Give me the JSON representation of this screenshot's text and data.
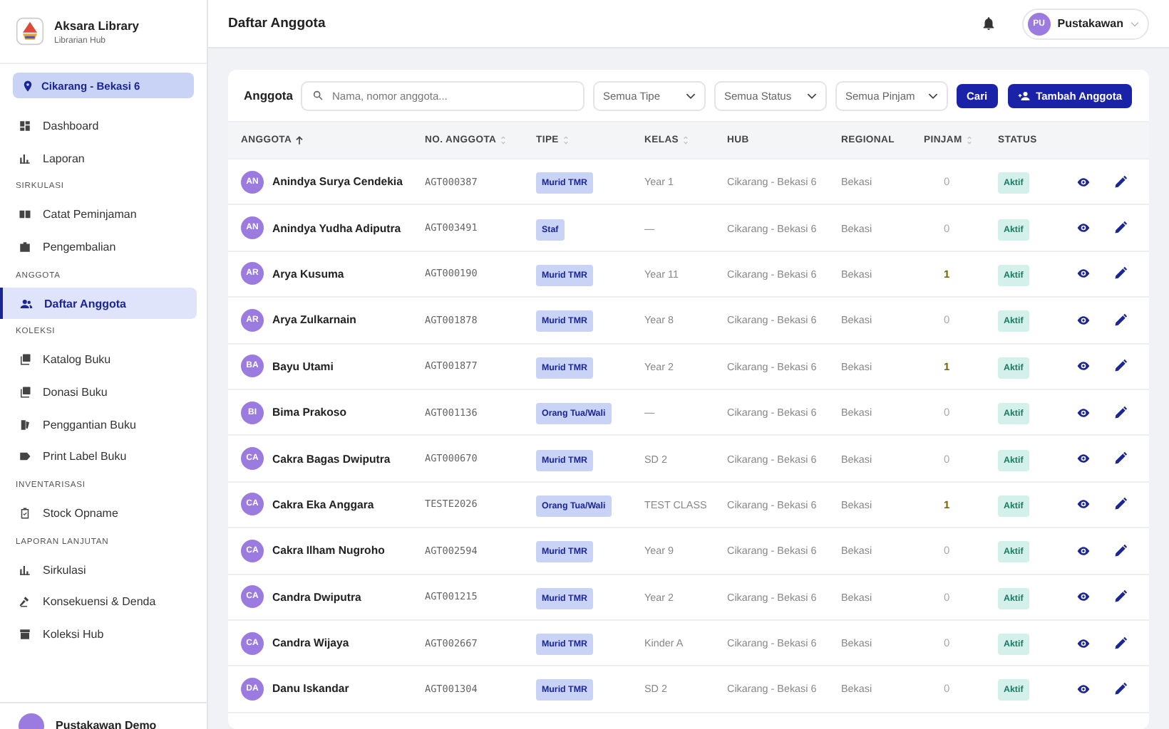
{
  "brand": {
    "name": "Aksara Library",
    "subtitle": "Librarian Hub"
  },
  "sidebar": {
    "location": "Cikarang - Bekasi 6",
    "sections": [
      {
        "items": [
          {
            "label": "Dashboard",
            "selected": false
          },
          {
            "label": "Laporan",
            "selected": false
          }
        ]
      },
      {
        "heading": "SIRKULASI",
        "items": [
          {
            "label": "Catat Peminjaman",
            "selected": false
          },
          {
            "label": "Pengembalian",
            "selected": false
          }
        ]
      },
      {
        "heading": "ANGGOTA",
        "items": [
          {
            "label": "Daftar Anggota",
            "selected": true
          }
        ]
      },
      {
        "heading": "KOLEKSI",
        "items": [
          {
            "label": "Katalog Buku",
            "selected": false
          },
          {
            "label": "Donasi Buku",
            "selected": false
          },
          {
            "label": "Penggantian Buku",
            "selected": false
          },
          {
            "label": "Print Label Buku",
            "selected": false
          }
        ]
      },
      {
        "heading": "INVENTARISASI",
        "items": [
          {
            "label": "Stock Opname",
            "selected": false
          }
        ]
      },
      {
        "heading": "LAPORAN LANJUTAN",
        "items": [
          {
            "label": "Sirkulasi",
            "selected": false
          },
          {
            "label": "Konsekuensi & Denda",
            "selected": false
          },
          {
            "label": "Koleksi Hub",
            "selected": false
          }
        ]
      }
    ],
    "user": "Pustakawan Demo"
  },
  "header": {
    "title": "Daftar Anggota",
    "user_initials": "PU",
    "user_name": "Pustakawan"
  },
  "toolbar": {
    "title": "Anggota",
    "search_placeholder": "Nama, nomor anggota...",
    "filters": [
      "Semua Tipe",
      "Semua Status",
      "Semua Pinjam"
    ],
    "search_button": "Cari",
    "add_button": "Tambah Anggota"
  },
  "table": {
    "columns": [
      {
        "label": "ANGGOTA",
        "sortable": true,
        "sorted": true
      },
      {
        "label": "NO. ANGGOTA",
        "sortable": true,
        "sorted": false
      },
      {
        "label": "TIPE",
        "sortable": true,
        "sorted": false
      },
      {
        "label": "KELAS",
        "sortable": true,
        "sorted": false
      },
      {
        "label": "HUB",
        "sortable": false,
        "sorted": false
      },
      {
        "label": "REGIONAL",
        "sortable": false,
        "sorted": false
      },
      {
        "label": "PINJAM",
        "sortable": true,
        "sorted": false
      },
      {
        "label": "STATUS",
        "sortable": false,
        "sorted": false
      }
    ],
    "rows": [
      {
        "initials": "AN",
        "name": "Anindya Surya Cendekia",
        "number": "AGT000387",
        "type": "Murid TMR",
        "class": "Year 1",
        "hub": "Cikarang - Bekasi 6",
        "regional": "Bekasi",
        "loans": "0",
        "has_loans": false,
        "status": "Aktif"
      },
      {
        "initials": "AN",
        "name": "Anindya Yudha Adiputra",
        "number": "AGT003491",
        "type": "Staf",
        "class": "—",
        "hub": "Cikarang - Bekasi 6",
        "regional": "Bekasi",
        "loans": "0",
        "has_loans": false,
        "status": "Aktif"
      },
      {
        "initials": "AR",
        "name": "Arya Kusuma",
        "number": "AGT000190",
        "type": "Murid TMR",
        "class": "Year 11",
        "hub": "Cikarang - Bekasi 6",
        "regional": "Bekasi",
        "loans": "1",
        "has_loans": true,
        "status": "Aktif"
      },
      {
        "initials": "AR",
        "name": "Arya Zulkarnain",
        "number": "AGT001878",
        "type": "Murid TMR",
        "class": "Year 8",
        "hub": "Cikarang - Bekasi 6",
        "regional": "Bekasi",
        "loans": "0",
        "has_loans": false,
        "status": "Aktif"
      },
      {
        "initials": "BA",
        "name": "Bayu Utami",
        "number": "AGT001877",
        "type": "Murid TMR",
        "class": "Year 2",
        "hub": "Cikarang - Bekasi 6",
        "regional": "Bekasi",
        "loans": "1",
        "has_loans": true,
        "status": "Aktif"
      },
      {
        "initials": "BI",
        "name": "Bima Prakoso",
        "number": "AGT001136",
        "type": "Orang Tua/Wali",
        "class": "—",
        "hub": "Cikarang - Bekasi 6",
        "regional": "Bekasi",
        "loans": "0",
        "has_loans": false,
        "status": "Aktif"
      },
      {
        "initials": "CA",
        "name": "Cakra Bagas Dwiputra",
        "number": "AGT000670",
        "type": "Murid TMR",
        "class": "SD 2",
        "hub": "Cikarang - Bekasi 6",
        "regional": "Bekasi",
        "loans": "0",
        "has_loans": false,
        "status": "Aktif"
      },
      {
        "initials": "CA",
        "name": "Cakra Eka Anggara",
        "number": "TESTE2026",
        "type": "Orang Tua/Wali",
        "class": "TEST CLASS",
        "hub": "Cikarang - Bekasi 6",
        "regional": "Bekasi",
        "loans": "1",
        "has_loans": true,
        "status": "Aktif"
      },
      {
        "initials": "CA",
        "name": "Cakra Ilham Nugroho",
        "number": "AGT002594",
        "type": "Murid TMR",
        "class": "Year 9",
        "hub": "Cikarang - Bekasi 6",
        "regional": "Bekasi",
        "loans": "0",
        "has_loans": false,
        "status": "Aktif"
      },
      {
        "initials": "CA",
        "name": "Candra Dwiputra",
        "number": "AGT001215",
        "type": "Murid TMR",
        "class": "Year 2",
        "hub": "Cikarang - Bekasi 6",
        "regional": "Bekasi",
        "loans": "0",
        "has_loans": false,
        "status": "Aktif"
      },
      {
        "initials": "CA",
        "name": "Candra Wijaya",
        "number": "AGT002667",
        "type": "Murid TMR",
        "class": "Kinder A",
        "hub": "Cikarang - Bekasi 6",
        "regional": "Bekasi",
        "loans": "0",
        "has_loans": false,
        "status": "Aktif"
      },
      {
        "initials": "DA",
        "name": "Danu Iskandar",
        "number": "AGT001304",
        "type": "Murid TMR",
        "class": "SD 2",
        "hub": "Cikarang - Bekasi 6",
        "regional": "Bekasi",
        "loans": "0",
        "has_loans": false,
        "status": "Aktif"
      }
    ]
  }
}
